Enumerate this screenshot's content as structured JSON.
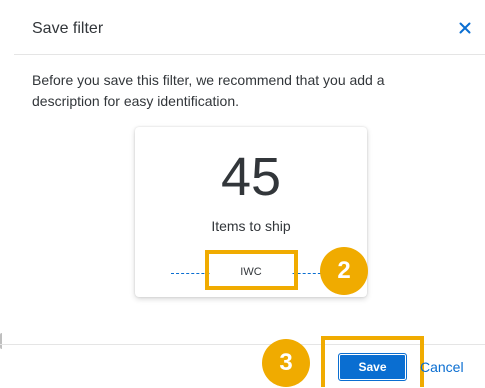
{
  "dialog": {
    "title": "Save filter",
    "close_icon": "close-icon",
    "description": "Before you save this filter, we recommend that you add a description for easy identification."
  },
  "tile": {
    "value": "45",
    "label": "Items to ship",
    "input_value": "IWC"
  },
  "callouts": {
    "step_2": "2",
    "step_3": "3"
  },
  "footer": {
    "save_label": "Save",
    "cancel_label": "Cancel"
  },
  "colors": {
    "accent": "#0a6ed1",
    "highlight": "#f0ab00",
    "text": "#32363a"
  }
}
